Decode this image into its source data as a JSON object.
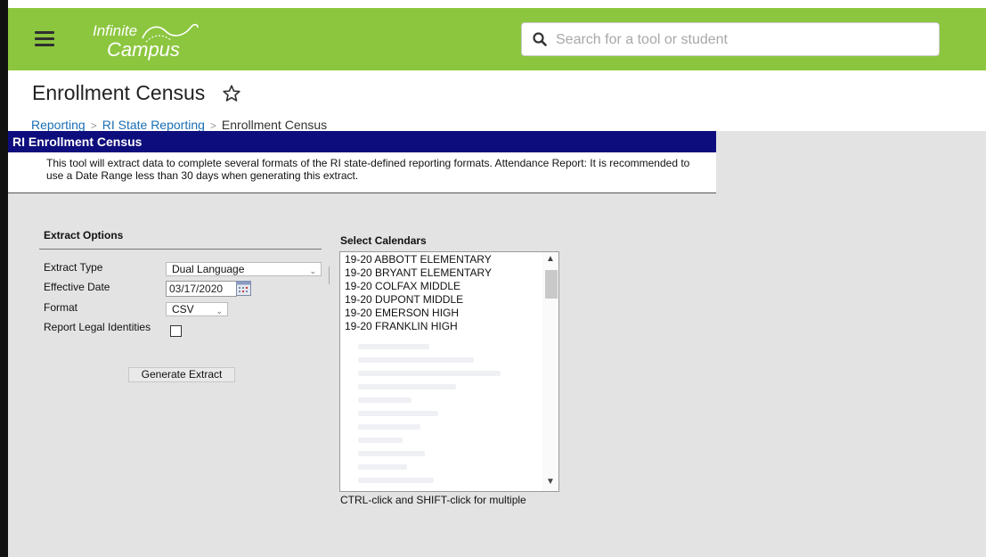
{
  "header": {
    "logo_line1": "Infinite",
    "logo_line2": "Campus",
    "search_placeholder": "Search for a tool or student",
    "brand_color": "#8cc63f"
  },
  "page": {
    "title": "Enrollment Census",
    "breadcrumb": [
      "Reporting",
      "RI State Reporting",
      "Enrollment Census"
    ]
  },
  "tool": {
    "header": "RI Enrollment Census",
    "header_color": "#0d0d7d",
    "description": "This tool will extract data to complete several formats of the RI state-defined reporting formats. Attendance Report: It is recommended to use a Date Range less than 30 days when generating this extract."
  },
  "extract_options": {
    "title": "Extract Options",
    "extract_type_label": "Extract Type",
    "extract_type_value": "Dual Language",
    "effective_date_label": "Effective Date",
    "effective_date_value": "03/17/2020",
    "format_label": "Format",
    "format_value": "CSV",
    "legal_identities_label": "Report Legal Identities",
    "legal_identities_checked": false,
    "generate_button": "Generate Extract"
  },
  "calendars": {
    "title": "Select Calendars",
    "items": [
      "19-20 ABBOTT ELEMENTARY",
      "19-20 BRYANT ELEMENTARY",
      "19-20 COLFAX MIDDLE",
      "19-20 DUPONT MIDDLE",
      "19-20 EMERSON HIGH",
      "19-20 FRANKLIN HIGH"
    ],
    "hint": "CTRL-click and SHIFT-click for multiple"
  }
}
